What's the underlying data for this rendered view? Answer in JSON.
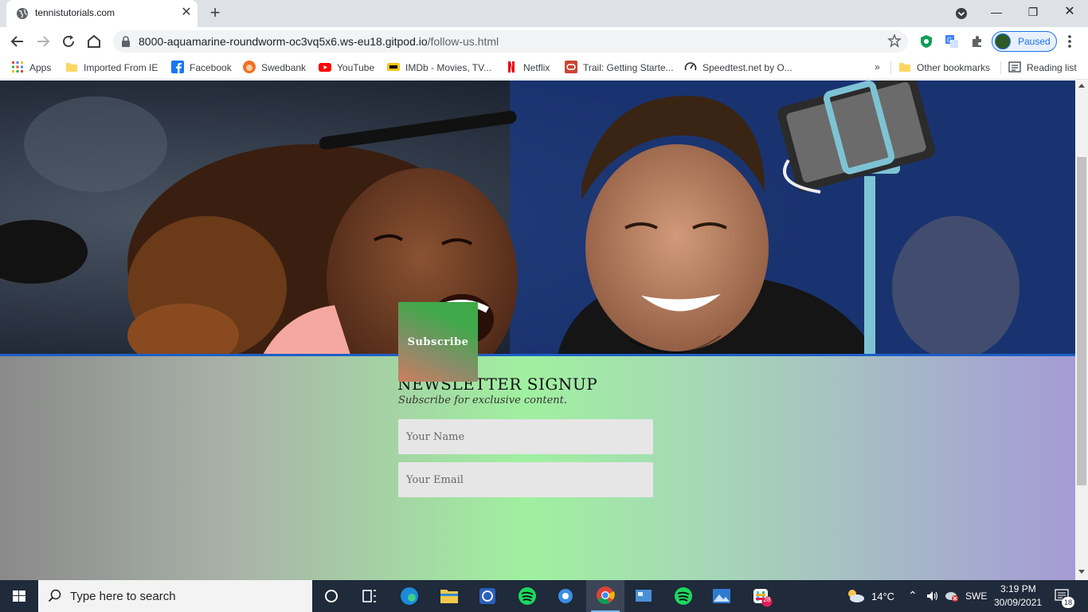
{
  "browser": {
    "tab_title": "tennistutorials.com",
    "url_host": "8000-aquamarine-roundworm-oc3vq5x6.ws-eu18.gitpod.io",
    "url_path": "/follow-us.html",
    "profile_label": "Paused"
  },
  "bookmarks": {
    "items": [
      {
        "label": "Apps",
        "icon": "apps-grid-icon"
      },
      {
        "label": "Imported From IE",
        "icon": "folder-icon"
      },
      {
        "label": "Facebook",
        "icon": "facebook-icon"
      },
      {
        "label": "Swedbank",
        "icon": "swedbank-icon"
      },
      {
        "label": "YouTube",
        "icon": "youtube-icon"
      },
      {
        "label": "IMDb - Movies, TV...",
        "icon": "imdb-icon"
      },
      {
        "label": "Netflix",
        "icon": "netflix-icon"
      },
      {
        "label": "Trail: Getting Starte...",
        "icon": "oracle-icon"
      },
      {
        "label": "Speedtest.net by O...",
        "icon": "speedtest-icon"
      }
    ],
    "overflow": "»",
    "other": "Other bookmarks",
    "reading_list": "Reading list"
  },
  "newsletter": {
    "heading": "NEWSLETTER SIGNUP",
    "subheading": "Subscribe for exclusive content.",
    "name_placeholder": "Your Name",
    "email_placeholder": "Your Email",
    "button_label": "Subscribe"
  },
  "taskbar": {
    "search_placeholder": "Type here to search",
    "weather": "14°C",
    "language": "SWE",
    "time": "3:19 PM",
    "date": "30/09/2021",
    "notification_count": "18",
    "slack_badge": "28"
  },
  "colors": {
    "accent": "#1a73e8",
    "gradient_left": "#8a8a8a",
    "gradient_mid": "#a0f0a0",
    "gradient_right": "#a59bd6"
  }
}
